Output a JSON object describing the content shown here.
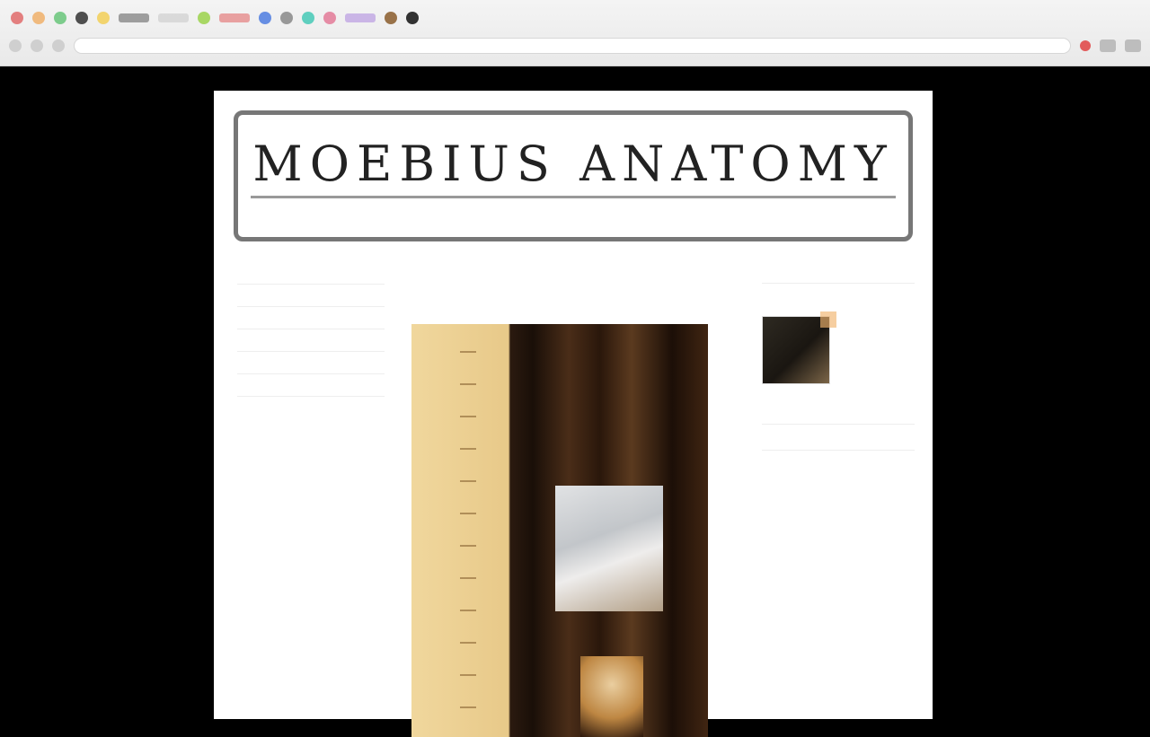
{
  "browser": {
    "bookmarks": [
      "",
      "",
      "",
      "",
      "",
      "",
      "",
      "",
      "",
      ""
    ],
    "url": ""
  },
  "site": {
    "title": "MOEBIUS ANATOMY",
    "subtitle": ""
  },
  "sidebar_left": {
    "items": [
      {
        "label": "",
        "small": ""
      },
      {
        "label": "",
        "small": ""
      },
      {
        "label": "",
        "small": ""
      },
      {
        "label": "",
        "small": ""
      },
      {
        "label": "",
        "small": ""
      },
      {
        "label": "",
        "small": ""
      }
    ]
  },
  "post": {
    "date": "",
    "title": ""
  },
  "sidebar_right": {
    "heading": "",
    "thumb_caption": "",
    "blocks": [
      {
        "label": "",
        "muted": ""
      },
      {
        "label": "",
        "muted": ""
      }
    ]
  },
  "colors": {
    "background": "#000000",
    "page": "#ffffff",
    "header_border": "#777777"
  }
}
